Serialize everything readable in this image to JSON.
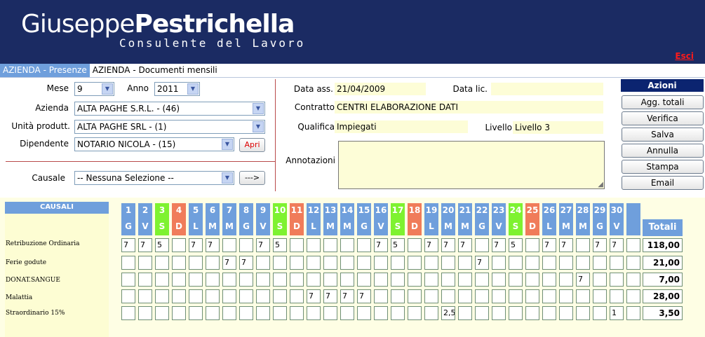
{
  "header": {
    "name_light": "Giuseppe",
    "name_bold": "Pestrichella",
    "subtitle": "Consulente del Lavoro",
    "logout": "Esci",
    "bg_color": "#1b2b63"
  },
  "tabs": [
    {
      "label": "AZIENDA - Presenze",
      "active": true
    },
    {
      "label": "AZIENDA - Documenti mensili",
      "active": false
    }
  ],
  "form": {
    "mese_label": "Mese",
    "mese_value": "9",
    "anno_label": "Anno",
    "anno_value": "2011",
    "azienda_label": "Azienda",
    "azienda_value": "ALTA PAGHE S.R.L. - (46)",
    "unita_label": "Unità produtt.",
    "unita_value": "ALTA PAGHE SRL - (1)",
    "dipendente_label": "Dipendente",
    "dipendente_value": "NOTARIO NICOLA - (15)",
    "apri_label": "Apri",
    "causale_label": "Causale",
    "causale_value": "-- Nessuna Selezione --",
    "go_label": "--->"
  },
  "info": {
    "data_ass_label": "Data ass.",
    "data_ass_value": "21/04/2009",
    "data_lic_label": "Data lic.",
    "data_lic_value": "",
    "contratto_label": "Contratto",
    "contratto_value": "CENTRI ELABORAZIONE DATI",
    "qualifica_label": "Qualifica",
    "qualifica_value": "Impiegati",
    "livello_label": "Livello",
    "livello_value": "Livello 3",
    "annotazioni_label": "Annotazioni",
    "annotazioni_value": ""
  },
  "actions": {
    "title": "Azioni",
    "buttons": [
      "Agg. totali",
      "Verifica",
      "Salva",
      "Annulla",
      "Stampa",
      "Email"
    ]
  },
  "grid": {
    "causali_title": "CAUSALI",
    "totali_title": "Totali",
    "days": [
      {
        "n": "1",
        "d": "G",
        "t": "w"
      },
      {
        "n": "2",
        "d": "V",
        "t": "w"
      },
      {
        "n": "3",
        "d": "S",
        "t": "sat"
      },
      {
        "n": "4",
        "d": "D",
        "t": "sun"
      },
      {
        "n": "5",
        "d": "L",
        "t": "w"
      },
      {
        "n": "6",
        "d": "M",
        "t": "w"
      },
      {
        "n": "7",
        "d": "M",
        "t": "w"
      },
      {
        "n": "8",
        "d": "G",
        "t": "w"
      },
      {
        "n": "9",
        "d": "V",
        "t": "w"
      },
      {
        "n": "10",
        "d": "S",
        "t": "sat"
      },
      {
        "n": "11",
        "d": "D",
        "t": "sun"
      },
      {
        "n": "12",
        "d": "L",
        "t": "w"
      },
      {
        "n": "13",
        "d": "M",
        "t": "w"
      },
      {
        "n": "14",
        "d": "M",
        "t": "w"
      },
      {
        "n": "15",
        "d": "G",
        "t": "w"
      },
      {
        "n": "16",
        "d": "V",
        "t": "w"
      },
      {
        "n": "17",
        "d": "S",
        "t": "sat"
      },
      {
        "n": "18",
        "d": "D",
        "t": "sun"
      },
      {
        "n": "19",
        "d": "L",
        "t": "w"
      },
      {
        "n": "20",
        "d": "M",
        "t": "w"
      },
      {
        "n": "21",
        "d": "M",
        "t": "w"
      },
      {
        "n": "22",
        "d": "G",
        "t": "w"
      },
      {
        "n": "23",
        "d": "V",
        "t": "w"
      },
      {
        "n": "24",
        "d": "S",
        "t": "sat"
      },
      {
        "n": "25",
        "d": "D",
        "t": "sun"
      },
      {
        "n": "26",
        "d": "L",
        "t": "w"
      },
      {
        "n": "27",
        "d": "M",
        "t": "w"
      },
      {
        "n": "28",
        "d": "M",
        "t": "w"
      },
      {
        "n": "29",
        "d": "G",
        "t": "w"
      },
      {
        "n": "30",
        "d": "V",
        "t": "w"
      },
      {
        "n": "",
        "d": "",
        "t": "blank"
      }
    ],
    "rows": [
      {
        "label": "Retribuzione Ordinaria",
        "total": "118,00",
        "values": [
          "7",
          "7",
          "5",
          "",
          "7",
          "7",
          "",
          "",
          "7",
          "5",
          "",
          "",
          "",
          "",
          "",
          "7",
          "5",
          "",
          "7",
          "7",
          "7",
          "",
          "7",
          "5",
          "",
          "7",
          "7",
          "",
          "7",
          "7",
          ""
        ]
      },
      {
        "label": "Ferie godute",
        "total": "21,00",
        "values": [
          "",
          "",
          "",
          "",
          "",
          "",
          "7",
          "7",
          "",
          "",
          "",
          "",
          "",
          "",
          "",
          "",
          "",
          "",
          "",
          "",
          "",
          "7",
          "",
          "",
          "",
          "",
          "",
          "",
          "",
          "",
          ""
        ]
      },
      {
        "label": "DONAT.SANGUE",
        "total": "7,00",
        "values": [
          "",
          "",
          "",
          "",
          "",
          "",
          "",
          "",
          "",
          "",
          "",
          "",
          "",
          "",
          "",
          "",
          "",
          "",
          "",
          "",
          "",
          "",
          "",
          "",
          "",
          "",
          "",
          "7",
          "",
          "",
          ""
        ]
      },
      {
        "label": "Malattia",
        "total": "28,00",
        "values": [
          "",
          "",
          "",
          "",
          "",
          "",
          "",
          "",
          "",
          "",
          "",
          "7",
          "7",
          "7",
          "7",
          "",
          "",
          "",
          "",
          "",
          "",
          "",
          "",
          "",
          "",
          "",
          "",
          "",
          "",
          "",
          ""
        ]
      },
      {
        "label": "Straordinario 15%",
        "total": "3,50",
        "values": [
          "",
          "",
          "",
          "",
          "",
          "",
          "",
          "",
          "",
          "",
          "",
          "",
          "",
          "",
          "",
          "",
          "",
          "",
          "",
          "2,5",
          "",
          "",
          "",
          "",
          "",
          "",
          "",
          "",
          "",
          "1",
          ""
        ]
      }
    ]
  }
}
